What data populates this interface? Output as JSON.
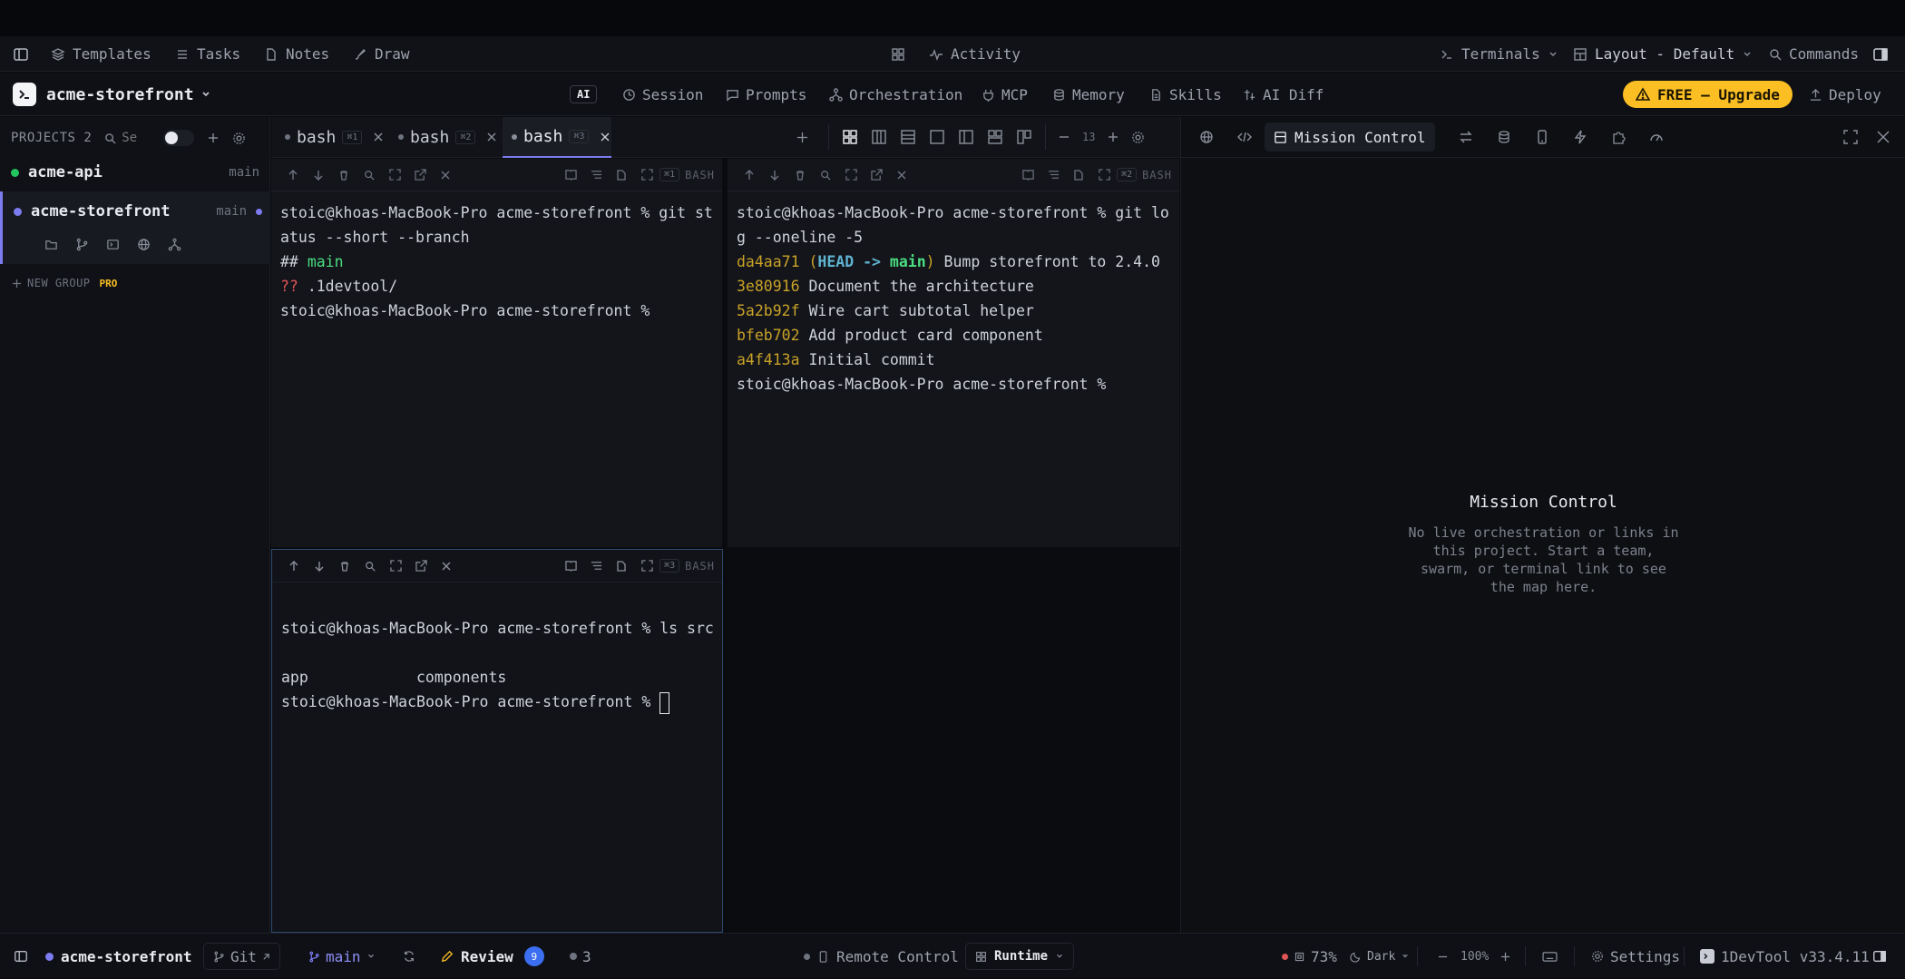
{
  "topbar": {
    "templates": "Templates",
    "tasks": "Tasks",
    "notes": "Notes",
    "draw": "Draw",
    "activity": "Activity",
    "terminals": "Terminals",
    "layout": "Layout - Default",
    "commands": "Commands"
  },
  "projectbar": {
    "project_name": "acme-storefront",
    "ai_badge": "AI",
    "nav": [
      "Session",
      "Prompts",
      "Orchestration",
      "MCP",
      "Memory",
      "Skills",
      "AI Diff"
    ],
    "upgrade": "FREE — Upgrade",
    "deploy": "Deploy"
  },
  "sidebar": {
    "header": "PROJECTS 2",
    "search_placeholder": "Se",
    "projects": [
      {
        "name": "acme-api",
        "branch": "main",
        "dot_color": "#22c55e"
      },
      {
        "name": "acme-storefront",
        "branch": "main",
        "dot_color": "#7c7cf0"
      }
    ],
    "new_group": "NEW GROUP",
    "pro_badge": "PRO"
  },
  "tabs": [
    {
      "label": "bash",
      "badge": "⌘1"
    },
    {
      "label": "bash",
      "badge": "⌘2"
    },
    {
      "label": "bash",
      "badge": "⌘3"
    }
  ],
  "font_size": "13",
  "panes": [
    {
      "badge": "⌘1",
      "shell": "BASH"
    },
    {
      "badge": "⌘2",
      "shell": "BASH"
    },
    {
      "badge": "⌘3",
      "shell": "BASH"
    }
  ],
  "term1": {
    "prompt": "stoic@khoas-MacBook-Pro acme-storefront % ",
    "cmd1": "git st",
    "cmd2": "atus --short --branch",
    "hash_prefix": "## ",
    "branch": "main",
    "untracked_prefix": "?? ",
    "untracked": ".1devtool/",
    "prompt_end": "stoic@khoas-MacBook-Pro acme-storefront %"
  },
  "term2": {
    "prompt": "stoic@khoas-MacBook-Pro acme-storefront % ",
    "cmd1": "git lo",
    "cmd2": "g --oneline -5",
    "commits": [
      {
        "hash": "da4aa71",
        "ref_open": "(",
        "head": "HEAD -> ",
        "ref_branch": "main",
        "ref_close": ")",
        "msg": " Bump storefront to 2.4.0"
      },
      {
        "hash": "3e80916",
        "msg": " Document the architecture"
      },
      {
        "hash": "5a2b92f",
        "msg": " Wire cart subtotal helper"
      },
      {
        "hash": "bfeb702",
        "msg": " Add product card component"
      },
      {
        "hash": "a4f413a",
        "msg": " Initial commit"
      }
    ],
    "prompt_end": "stoic@khoas-MacBook-Pro acme-storefront %"
  },
  "term3": {
    "prompt": "stoic@khoas-MacBook-Pro acme-storefront % ",
    "cmd": "ls src",
    "out1": "app",
    "out2": "components",
    "prompt_end": "stoic@khoas-MacBook-Pro acme-storefront % "
  },
  "rightpanel": {
    "tab_label": "Mission Control",
    "title": "Mission Control",
    "body": "No live orchestration or links in\nthis project. Start a team,\nswarm, or terminal link to see\nthe map here."
  },
  "statusbar": {
    "project": "acme-storefront",
    "git": "Git",
    "branch": "main",
    "review": "Review",
    "review_count": "9",
    "count": "3",
    "remote": "Remote Control",
    "runtime": "Runtime",
    "cpu": "73%",
    "theme": "Dark",
    "zoom": "100%",
    "settings": "Settings",
    "version": "1DevTool v33.4.11"
  },
  "colors": {
    "accent": "#7c7cf0",
    "upgrade_bg": "#fbbf24",
    "commit_hash": "#c9a227",
    "branch_green": "#4ade80",
    "head_cyan": "#5fb4d0",
    "untracked_red": "#e05555"
  }
}
